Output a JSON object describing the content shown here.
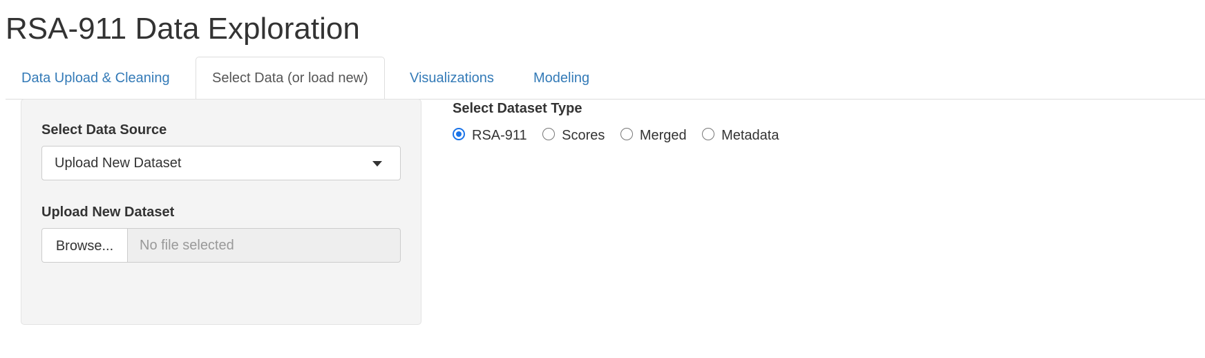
{
  "app": {
    "title": "RSA-911 Data Exploration"
  },
  "tabs": [
    {
      "label": "Data Upload & Cleaning",
      "active": false
    },
    {
      "label": "Select Data (or load new)",
      "active": true
    },
    {
      "label": "Visualizations",
      "active": false
    },
    {
      "label": "Modeling",
      "active": false
    }
  ],
  "sidebar": {
    "data_source": {
      "label": "Select Data Source",
      "selected": "Upload New Dataset",
      "icon": "caret-down-icon"
    },
    "upload": {
      "label": "Upload New Dataset",
      "browse_label": "Browse...",
      "file_display": "No file selected"
    }
  },
  "main": {
    "dataset_type": {
      "label": "Select Dataset Type",
      "options": [
        {
          "label": "RSA-911",
          "checked": true
        },
        {
          "label": "Scores",
          "checked": false
        },
        {
          "label": "Merged",
          "checked": false
        },
        {
          "label": "Metadata",
          "checked": false
        }
      ]
    }
  },
  "colors": {
    "link": "#337ab7",
    "radio_accent": "#1a73e8",
    "panel_bg": "#f4f4f4"
  }
}
